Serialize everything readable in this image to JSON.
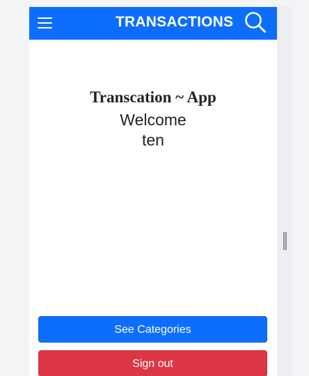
{
  "header": {
    "title": "TRANSACTIONS",
    "menu_icon": "hamburger-menu-icon",
    "search_icon": "search-icon"
  },
  "main": {
    "heading": "Transcation ~ App",
    "welcome": "Welcome",
    "username": "ten"
  },
  "actions": {
    "see_categories": "See Categories",
    "sign_out": "Sign out"
  },
  "colors": {
    "primary": "#0d6efd",
    "danger": "#dc3545",
    "text": "#222222",
    "background": "#f3f4f6"
  }
}
